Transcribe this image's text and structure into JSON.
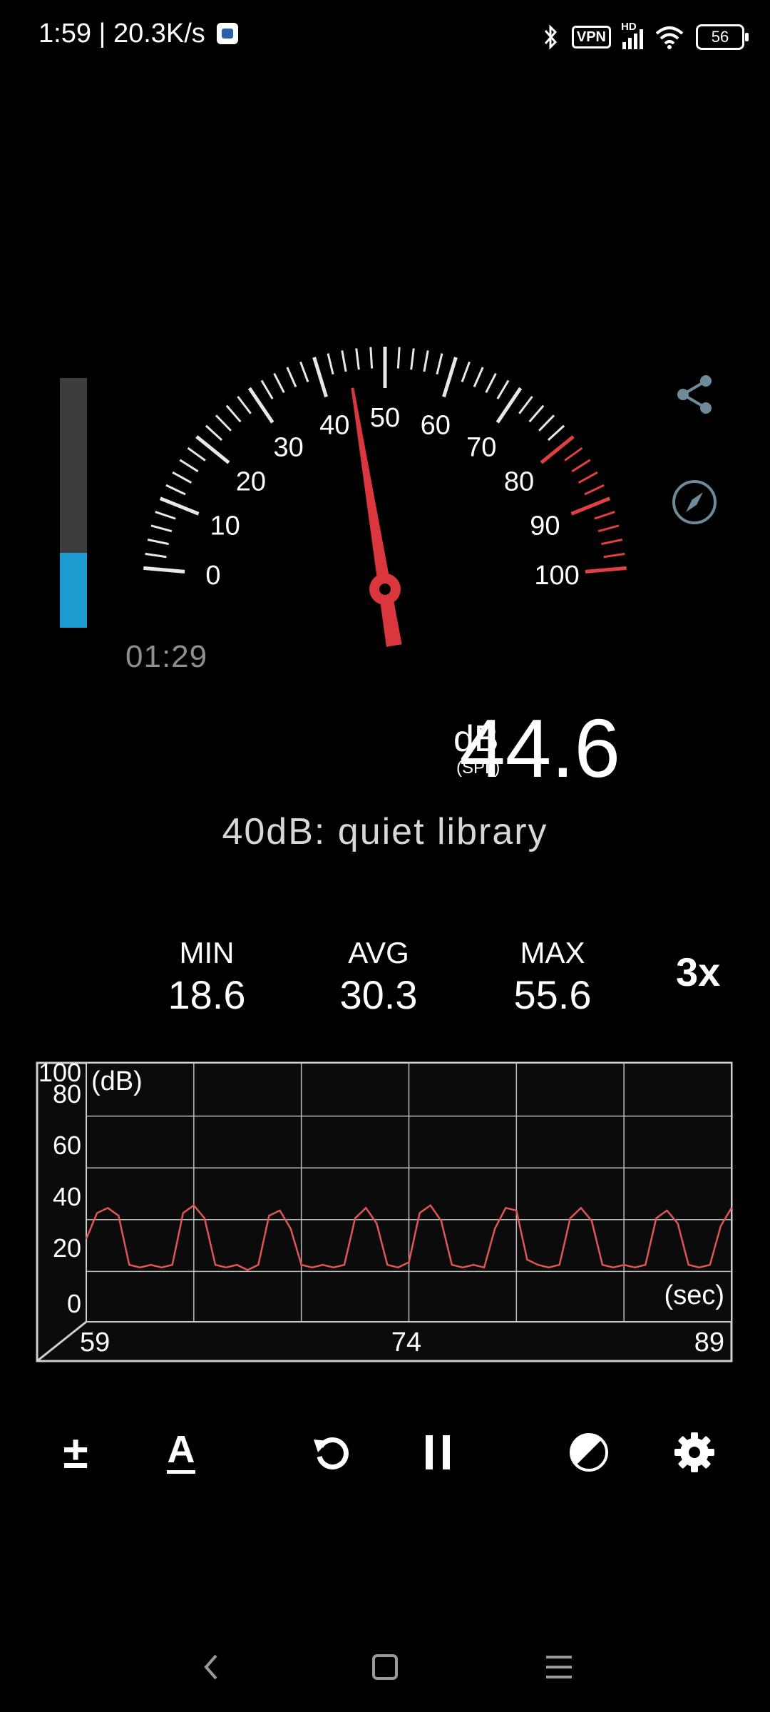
{
  "status_bar": {
    "time_speed": "1:59 | 20.3K/s",
    "vpn": "VPN",
    "hd": "HD",
    "battery": "56"
  },
  "meter": {
    "dial_labels": [
      "0",
      "10",
      "20",
      "30",
      "40",
      "50",
      "60",
      "70",
      "80",
      "90",
      "100"
    ],
    "needle_value_db": 44.6,
    "level_fraction": 0.3,
    "peak_fraction": 0.46,
    "elapsed": "01:29"
  },
  "reading": {
    "value": "44.6",
    "unit": "dB",
    "unit_sub": "(SPL)",
    "reference": "40dB: quiet library"
  },
  "stats": {
    "min_label": "MIN",
    "min_value": "18.6",
    "avg_label": "AVG",
    "avg_value": "30.3",
    "max_label": "MAX",
    "max_value": "55.6",
    "speed": "3x"
  },
  "chart_data": {
    "type": "line",
    "ylabel": "(dB)",
    "xlabel": "(sec)",
    "ylim": [
      0,
      100
    ],
    "yticks": [
      "100",
      "80",
      "60",
      "40",
      "20",
      "0"
    ],
    "xticks": [
      "59",
      "74",
      "89"
    ],
    "xlim": [
      59,
      89
    ],
    "grid": true,
    "series": [
      {
        "color": "#e05555",
        "x": [
          59,
          59.5,
          60,
          60.5,
          61,
          61.5,
          62,
          62.5,
          63,
          63.5,
          64,
          64.5,
          65,
          65.5,
          66,
          66.5,
          67,
          67.5,
          68,
          68.5,
          69,
          69.5,
          70,
          70.5,
          71,
          71.5,
          72,
          72.5,
          73,
          73.5,
          74,
          74.5,
          75,
          75.5,
          76,
          76.5,
          77,
          77.5,
          78,
          78.5,
          79,
          79.5,
          80,
          80.5,
          81,
          81.5,
          82,
          82.5,
          83,
          83.5,
          84,
          84.5,
          85,
          85.5,
          86,
          86.5,
          87,
          87.5,
          88,
          88.5,
          89
        ],
        "y": [
          32,
          42,
          44,
          41,
          22,
          21,
          22,
          21,
          22,
          42,
          45,
          40,
          22,
          21,
          22,
          20,
          22,
          41,
          43,
          36,
          22,
          21,
          22,
          21,
          22,
          40,
          44,
          38,
          22,
          21,
          23,
          42,
          45,
          39,
          22,
          21,
          22,
          21,
          36,
          44,
          43,
          24,
          22,
          21,
          22,
          40,
          44,
          39,
          22,
          21,
          22,
          21,
          22,
          40,
          43,
          38,
          22,
          21,
          22,
          37,
          44
        ]
      }
    ]
  },
  "toolbar": {
    "calibrate": "±",
    "weighting": "A"
  }
}
